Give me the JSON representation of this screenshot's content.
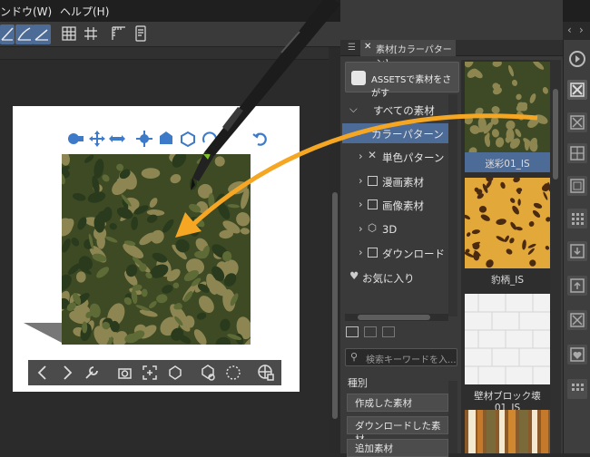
{
  "menu": {
    "window": "ンドウ(W)",
    "help": "ヘルプ(H)"
  },
  "panel": {
    "tab_title": "素材[カラーパターン]",
    "assets_button": "ASSETSで素材をさがす",
    "tree": [
      {
        "label": "すべての素材",
        "icon": "grid-dots-icon",
        "selected": false
      },
      {
        "label": "カラーパターン",
        "icon": "color-pattern-icon",
        "selected": true
      },
      {
        "label": "単色パターン",
        "icon": "mono-pattern-icon",
        "selected": false
      },
      {
        "label": "漫画素材",
        "icon": "manga-icon",
        "selected": false
      },
      {
        "label": "画像素材",
        "icon": "image-icon",
        "selected": false
      },
      {
        "label": "3D",
        "icon": "cube-icon",
        "selected": false
      },
      {
        "label": "ダウンロード",
        "icon": "download-icon",
        "selected": false
      },
      {
        "label": "お気に入り",
        "icon": "heart-icon",
        "selected": false
      }
    ],
    "search_placeholder": "検索キーワードを入...",
    "kind_label": "種別",
    "tags": [
      "作成した素材",
      "ダウンロードした素材",
      "追加素材"
    ],
    "thumbnails": [
      {
        "label": "迷彩01_IS",
        "selected": true
      },
      {
        "label": "豹柄_IS",
        "selected": false
      },
      {
        "label": "壁材ブロック壊01_IS",
        "selected": false
      }
    ]
  },
  "colors": {
    "accent": "#4d6b97",
    "arrow": "#f5a623",
    "manipulator_icon": "#3d7ac8"
  }
}
